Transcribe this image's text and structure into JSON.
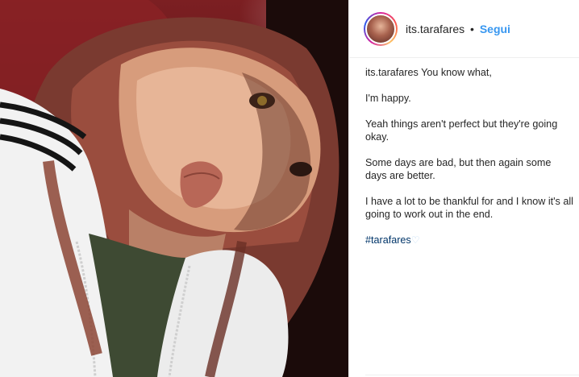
{
  "post": {
    "username": "its.tarafares",
    "separator": "•",
    "follow_label": "Segui"
  },
  "caption": {
    "username": "its.tarafares",
    "first_line": "You know what,",
    "paragraphs": [
      "I'm happy.",
      "Yeah things aren't perfect but they're going okay.",
      "Some days are bad, but then again some days are better.",
      "I have a lot to be thankful for and I know it's all going to work out in the end."
    ],
    "hashtag": "#tarafares",
    "hashtag_emoji": "♡"
  },
  "colors": {
    "follow": "#3897f0",
    "hashtag": "#003569",
    "text": "#262626"
  }
}
